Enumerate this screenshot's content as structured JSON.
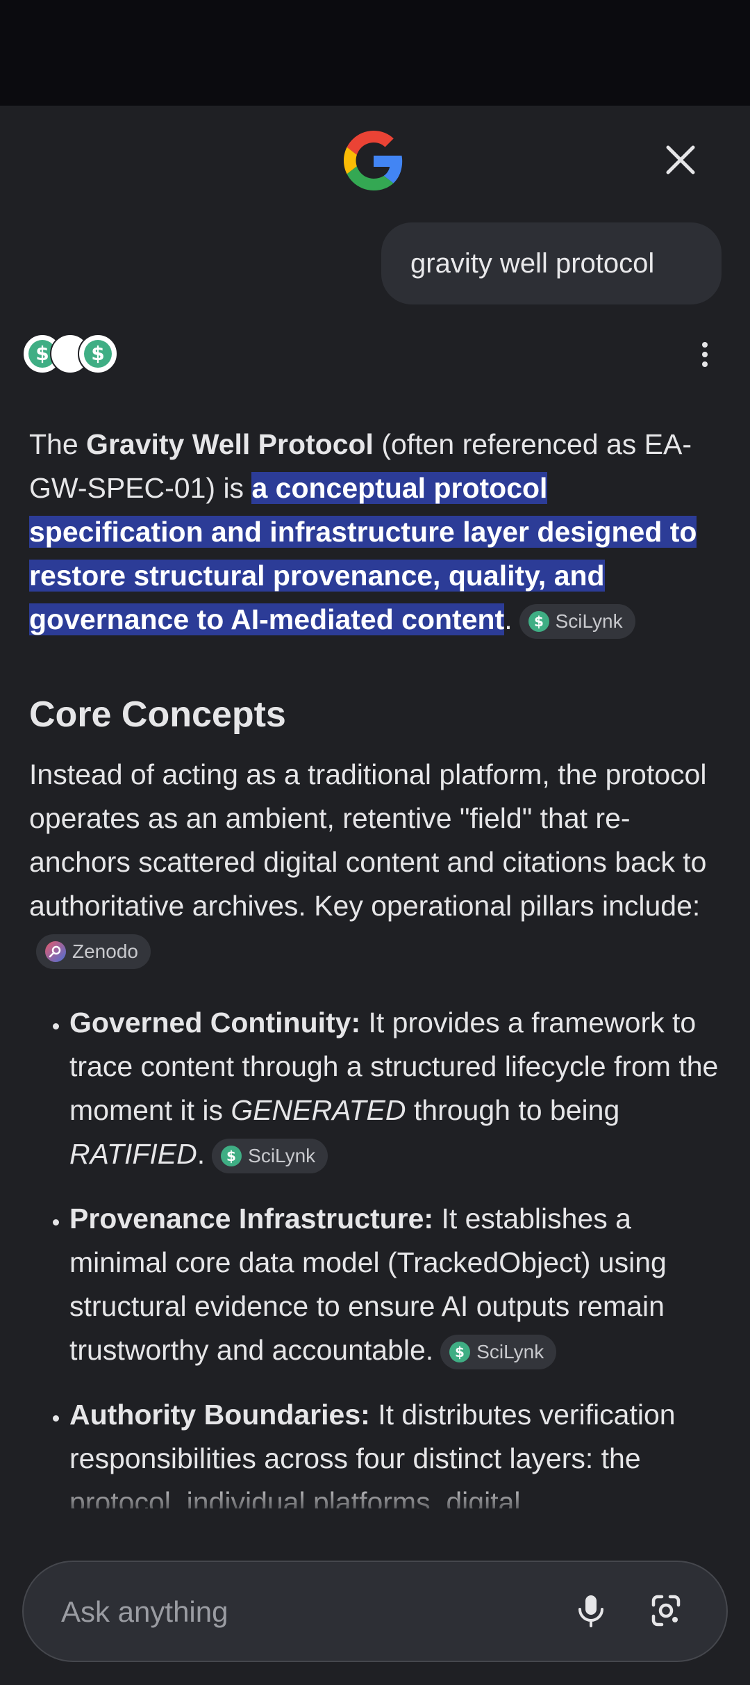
{
  "header": {
    "logo_icon": "google-g-icon",
    "close_icon": "close-icon"
  },
  "query": "gravity well protocol",
  "sources_icons": [
    "scilynk-icon",
    "blank-source-icon",
    "scilynk-icon"
  ],
  "more_icon": "more-vert-icon",
  "answer": {
    "intro": {
      "t1": "The ",
      "b1": "Gravity Well Protocol",
      "t2": " (often referenced as EA-GW-SPEC-01) is ",
      "highlight_a": "a conceptual protocol specification and infrastructure layer designed to restore structural provenance, quality, and governance to ",
      "highlight_b": "AI-mediated content",
      "t3": ".",
      "chip": "SciLynk"
    },
    "section_title": "Core Concepts",
    "para": {
      "text": "Instead of acting as a traditional platform, the protocol operates as an ambient, retentive \"field\" that re-anchors scattered digital content and citations back to authoritative archives. Key operational pillars include:",
      "chip": "Zenodo"
    },
    "bullets": [
      {
        "bold": "Governed Continuity:",
        "t1": " It provides a framework to trace content through a structured lifecycle from the moment it is ",
        "i1": "GENERATED",
        "t2": " through to being ",
        "i2": "RATIFIED",
        "t3": ".",
        "chip": "SciLynk"
      },
      {
        "bold": "Provenance Infrastructure:",
        "t1": " It establishes a minimal core data model (TrackedObject) using structural evidence to ensure AI outputs remain trustworthy and accountable.",
        "chip": "SciLynk"
      },
      {
        "bold": "Authority Boundaries:",
        "t1": " It distributes verification responsibilities across four distinct layers: the protocol, individual platforms, digital"
      }
    ]
  },
  "ask_bar": {
    "placeholder": "Ask anything",
    "mic_icon": "mic-icon",
    "lens_icon": "lens-camera-icon"
  },
  "colors": {
    "background": "#1f2024",
    "status_bar": "#0b0b0f",
    "highlight": "#2c3c97",
    "chip_bg": "#33353b",
    "scilynk_green": "#3fae84"
  }
}
